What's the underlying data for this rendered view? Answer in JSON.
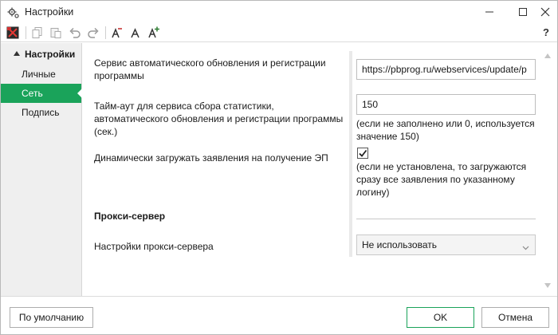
{
  "window": {
    "title": "Настройки"
  },
  "toolbar": {
    "icons": [
      "export-icon",
      "copy-icon",
      "paste-icon",
      "undo-icon",
      "redo-icon",
      "font-decrease-icon",
      "font-normal-icon",
      "font-increase-icon",
      "help-icon"
    ],
    "help_label": "?"
  },
  "sidebar": {
    "group_label": "Настройки",
    "items": [
      {
        "label": "Личные",
        "active": false
      },
      {
        "label": "Сеть",
        "active": true
      },
      {
        "label": "Подпись",
        "active": false
      }
    ]
  },
  "form": {
    "service_label": "Сервис автоматического обновления и регистрации программы",
    "service_value": "https://pbprog.ru/webservices/update/p",
    "timeout_label": "Тайм-аут для сервиса сбора статистики, автоматического обновления и регистрации программы (сек.)",
    "timeout_value": "150",
    "timeout_hint": "(если не заполнено или 0, используется значение 150)",
    "dynamic_label": "Динамически загружать заявления на получение ЭП",
    "dynamic_checked": true,
    "dynamic_hint": "(если не установлена, то загружаются сразу все заявления по указанному логину)",
    "proxy_section": "Прокси-сервер",
    "proxy_label": "Настройки прокси-сервера",
    "proxy_value": "Не использовать"
  },
  "footer": {
    "default_button": "По умолчанию",
    "ok_button": "OK",
    "cancel_button": "Отмена"
  },
  "colors": {
    "accent": "#1aa35a"
  }
}
